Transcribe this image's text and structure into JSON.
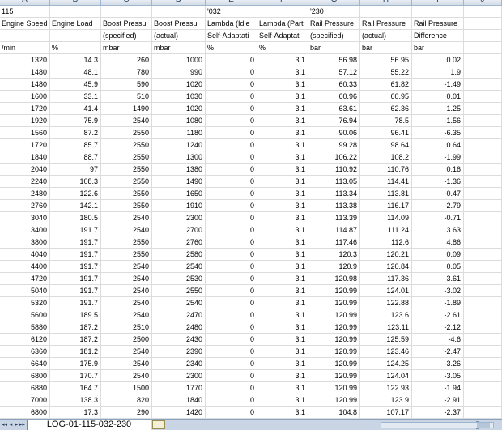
{
  "column_headers": [
    "A",
    "B",
    "C",
    "D",
    "E",
    "F",
    "G",
    "H",
    "I",
    "J"
  ],
  "rows": [
    [
      "115",
      "",
      "",
      "",
      "'032",
      "",
      "'230",
      "",
      "",
      ""
    ],
    [
      "Engine Speed",
      "Engine Load",
      "Boost Pressu",
      "Boost Pressu",
      "Lambda (Idle",
      "Lambda (Part",
      "Rail Pressure",
      "Rail Pressure",
      "Rail Pressure",
      ""
    ],
    [
      "",
      "",
      "(specified)",
      "(actual)",
      "Self-Adaptati",
      "Self-Adaptati",
      "(specified)",
      "(actual)",
      "Difference",
      ""
    ],
    [
      "/min",
      "%",
      "mbar",
      "mbar",
      "%",
      "%",
      "bar",
      "bar",
      "bar",
      ""
    ],
    [
      "1320",
      "14.3",
      "260",
      "1000",
      "0",
      "3.1",
      "56.98",
      "56.95",
      "0.02",
      ""
    ],
    [
      "1480",
      "48.1",
      "780",
      "990",
      "0",
      "3.1",
      "57.12",
      "55.22",
      "1.9",
      ""
    ],
    [
      "1480",
      "45.9",
      "590",
      "1020",
      "0",
      "3.1",
      "60.33",
      "61.82",
      "-1.49",
      ""
    ],
    [
      "1600",
      "33.1",
      "510",
      "1030",
      "0",
      "3.1",
      "60.96",
      "60.95",
      "0.01",
      ""
    ],
    [
      "1720",
      "41.4",
      "1490",
      "1020",
      "0",
      "3.1",
      "63.61",
      "62.36",
      "1.25",
      ""
    ],
    [
      "1920",
      "75.9",
      "2540",
      "1080",
      "0",
      "3.1",
      "76.94",
      "78.5",
      "-1.56",
      ""
    ],
    [
      "1560",
      "87.2",
      "2550",
      "1180",
      "0",
      "3.1",
      "90.06",
      "96.41",
      "-6.35",
      ""
    ],
    [
      "1720",
      "85.7",
      "2550",
      "1240",
      "0",
      "3.1",
      "99.28",
      "98.64",
      "0.64",
      ""
    ],
    [
      "1840",
      "88.7",
      "2550",
      "1300",
      "0",
      "3.1",
      "106.22",
      "108.2",
      "-1.99",
      ""
    ],
    [
      "2040",
      "97",
      "2550",
      "1380",
      "0",
      "3.1",
      "110.92",
      "110.76",
      "0.16",
      ""
    ],
    [
      "2240",
      "108.3",
      "2550",
      "1490",
      "0",
      "3.1",
      "113.05",
      "114.41",
      "-1.36",
      ""
    ],
    [
      "2480",
      "122.6",
      "2550",
      "1650",
      "0",
      "3.1",
      "113.34",
      "113.81",
      "-0.47",
      ""
    ],
    [
      "2760",
      "142.1",
      "2550",
      "1910",
      "0",
      "3.1",
      "113.38",
      "116.17",
      "-2.79",
      ""
    ],
    [
      "3040",
      "180.5",
      "2540",
      "2300",
      "0",
      "3.1",
      "113.39",
      "114.09",
      "-0.71",
      ""
    ],
    [
      "3400",
      "191.7",
      "2540",
      "2700",
      "0",
      "3.1",
      "114.87",
      "111.24",
      "3.63",
      ""
    ],
    [
      "3800",
      "191.7",
      "2550",
      "2760",
      "0",
      "3.1",
      "117.46",
      "112.6",
      "4.86",
      ""
    ],
    [
      "4040",
      "191.7",
      "2550",
      "2580",
      "0",
      "3.1",
      "120.3",
      "120.21",
      "0.09",
      ""
    ],
    [
      "4400",
      "191.7",
      "2540",
      "2540",
      "0",
      "3.1",
      "120.9",
      "120.84",
      "0.05",
      ""
    ],
    [
      "4720",
      "191.7",
      "2540",
      "2530",
      "0",
      "3.1",
      "120.98",
      "117.36",
      "3.61",
      ""
    ],
    [
      "5040",
      "191.7",
      "2540",
      "2550",
      "0",
      "3.1",
      "120.99",
      "124.01",
      "-3.02",
      ""
    ],
    [
      "5320",
      "191.7",
      "2540",
      "2540",
      "0",
      "3.1",
      "120.99",
      "122.88",
      "-1.89",
      ""
    ],
    [
      "5600",
      "189.5",
      "2540",
      "2470",
      "0",
      "3.1",
      "120.99",
      "123.6",
      "-2.61",
      ""
    ],
    [
      "5880",
      "187.2",
      "2510",
      "2480",
      "0",
      "3.1",
      "120.99",
      "123.11",
      "-2.12",
      ""
    ],
    [
      "6120",
      "187.2",
      "2500",
      "2430",
      "0",
      "3.1",
      "120.99",
      "125.59",
      "-4.6",
      ""
    ],
    [
      "6360",
      "181.2",
      "2540",
      "2390",
      "0",
      "3.1",
      "120.99",
      "123.46",
      "-2.47",
      ""
    ],
    [
      "6640",
      "175.9",
      "2540",
      "2340",
      "0",
      "3.1",
      "120.99",
      "124.25",
      "-3.26",
      ""
    ],
    [
      "6800",
      "170.7",
      "2540",
      "2300",
      "0",
      "3.1",
      "120.99",
      "124.04",
      "-3.05",
      ""
    ],
    [
      "6880",
      "164.7",
      "1500",
      "1770",
      "0",
      "3.1",
      "120.99",
      "122.93",
      "-1.94",
      ""
    ],
    [
      "7000",
      "138.3",
      "820",
      "1840",
      "0",
      "3.1",
      "120.99",
      "123.9",
      "-2.91",
      ""
    ],
    [
      "6800",
      "17.3",
      "290",
      "1420",
      "0",
      "3.1",
      "104.8",
      "107.17",
      "-2.37",
      ""
    ]
  ],
  "sheet_tab": "LOG-01-115-032-230",
  "nav_buttons": [
    "◂◂",
    "◂",
    "▸",
    "▸▸"
  ]
}
